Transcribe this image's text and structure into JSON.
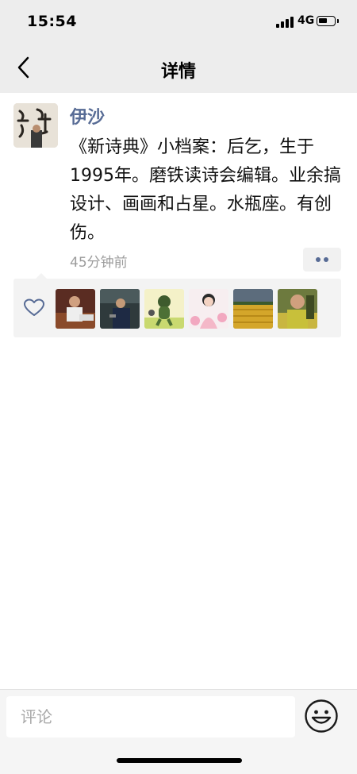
{
  "status_bar": {
    "time": "15:54",
    "network": "4G",
    "battery_level": 0.6
  },
  "nav": {
    "title": "详情",
    "back_icon": "chevron-left-icon"
  },
  "post": {
    "author": "伊沙",
    "avatar_icon": "calligraphy-avatar-icon",
    "content": "《新诗典》小档案：后乞，生于1995年。磨铁读诗会编辑。业余搞设计、画画和占星。水瓶座。有创伤。",
    "time_ago": "45分钟前",
    "more_icon": "more-dots-icon"
  },
  "likes": {
    "heart_icon": "heart-outline-icon",
    "avatars": [
      {
        "icon": "liker-avatar-man-icon"
      },
      {
        "icon": "liker-avatar-speaker-icon"
      },
      {
        "icon": "liker-avatar-cartoon-icon"
      },
      {
        "icon": "liker-avatar-girl-illustration-icon"
      },
      {
        "icon": "liker-avatar-field-icon"
      },
      {
        "icon": "liker-avatar-elder-icon"
      }
    ]
  },
  "composer": {
    "placeholder": "评论",
    "emoji_icon": "emoji-icon"
  },
  "colors": {
    "link": "#576b95",
    "header_bg": "#ededed",
    "likes_bg": "#f3f3f3"
  }
}
